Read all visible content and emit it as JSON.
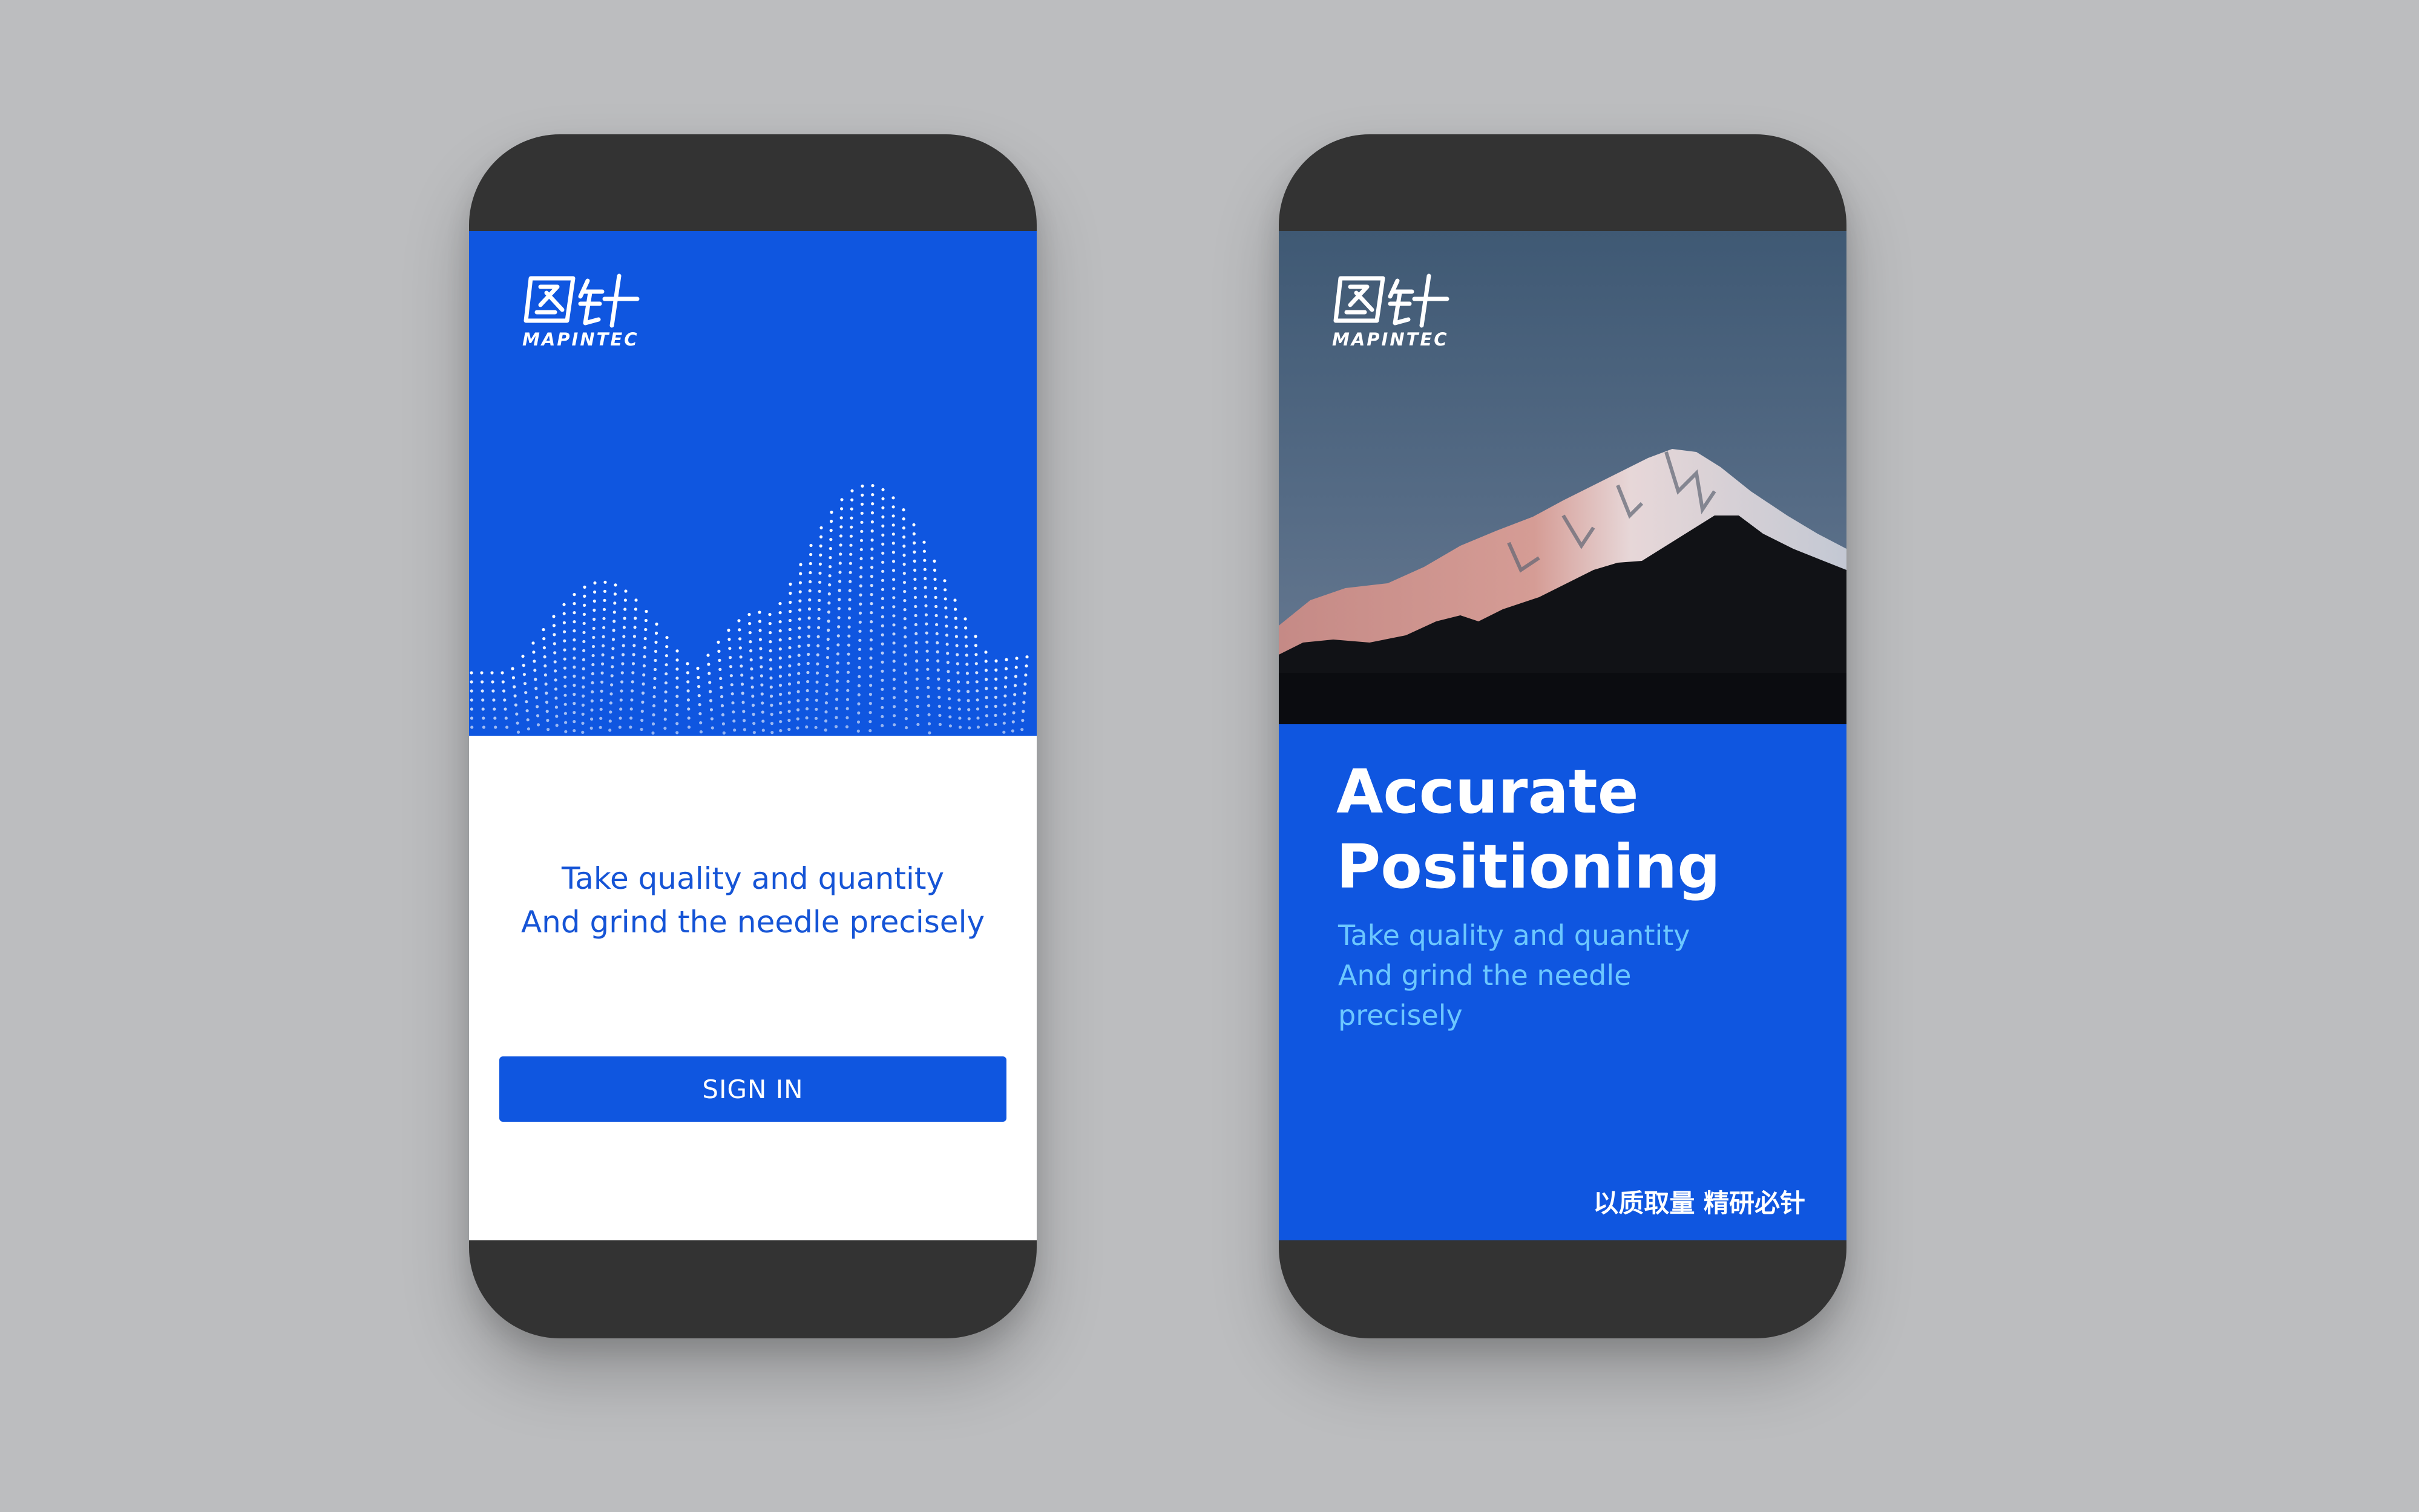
{
  "brand": {
    "logo_text": "MAPINTEC",
    "logo_glyphs": "图针"
  },
  "left_screen": {
    "tagline_line1": "Take quality and quantity",
    "tagline_line2": "And grind the needle precisely",
    "signin_label": "SIGN IN"
  },
  "right_screen": {
    "headline_line1": "Accurate",
    "headline_line2": "Positioning",
    "subline_line1": "Take quality and quantity",
    "subline_line2": "And grind the needle",
    "subline_line3": "precisely",
    "cn_slogan": "以质取量 精研必针"
  },
  "colors": {
    "background": "#bcbdbf",
    "phone_frame": "#333333",
    "brand_blue": "#0f56e0",
    "text_blue": "#1554d6",
    "light_cyan": "#6cc7ff",
    "white": "#ffffff"
  },
  "icons": {
    "logo_mark": "mapintec-logo-mark",
    "mountain_dots": "dotted-mountain-graphic",
    "mountain_photo": "mountain-peak-photo"
  }
}
